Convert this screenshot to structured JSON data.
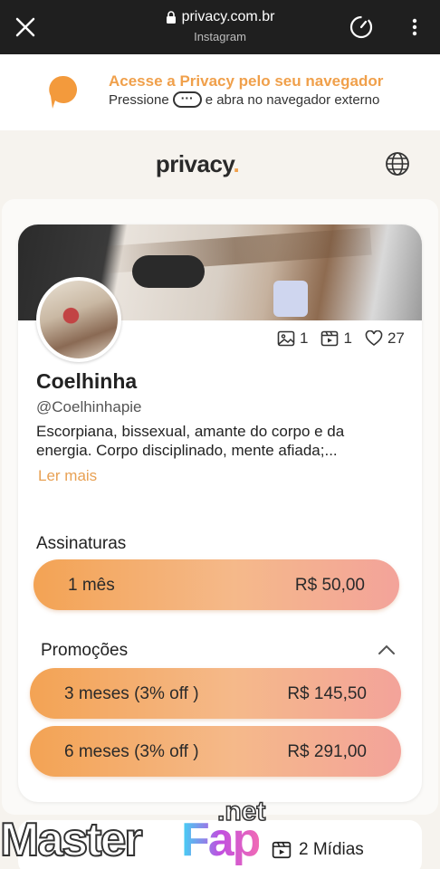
{
  "browser": {
    "url": "privacy.com.br",
    "subtitle": "Instagram",
    "icons": [
      "close-icon",
      "lock-icon",
      "timer-icon",
      "more-vertical-icon"
    ]
  },
  "banner": {
    "title": "Acesse a Privacy pelo seu navegador",
    "press": "Pressione",
    "dots": "···",
    "rest": "e abra no navegador externo",
    "accent": "#f0a04b"
  },
  "site": {
    "brand": "privacy",
    "brand_dot": "."
  },
  "profile": {
    "stats": {
      "images": "1",
      "videos": "1",
      "likes": "27"
    },
    "name": "Coelhinha",
    "handle": "@Coelhinhapie",
    "bio": "Escorpiana, bissexual, amante do corpo e da energia. Corpo disciplinado, mente afiada;...",
    "read_more": "Ler mais"
  },
  "subscriptions": {
    "title": "Assinaturas",
    "plans": [
      {
        "label": "1 mês",
        "price": "R$ 50,00"
      }
    ]
  },
  "promotions": {
    "title": "Promoções",
    "plans": [
      {
        "label": "3 meses (3% off )",
        "price": "R$ 145,50"
      },
      {
        "label": "6 meses (3% off )",
        "price": "R$ 291,00"
      }
    ]
  },
  "bottom": {
    "media": "2 Mídias"
  },
  "watermark": {
    "master": "Master",
    "fap": "Fap",
    "net": ".net"
  },
  "colors": {
    "accent": "#f0a04b",
    "pill_start": "#f3a354",
    "pill_end": "#f3a39a",
    "topbar": "#1f1f1f"
  }
}
